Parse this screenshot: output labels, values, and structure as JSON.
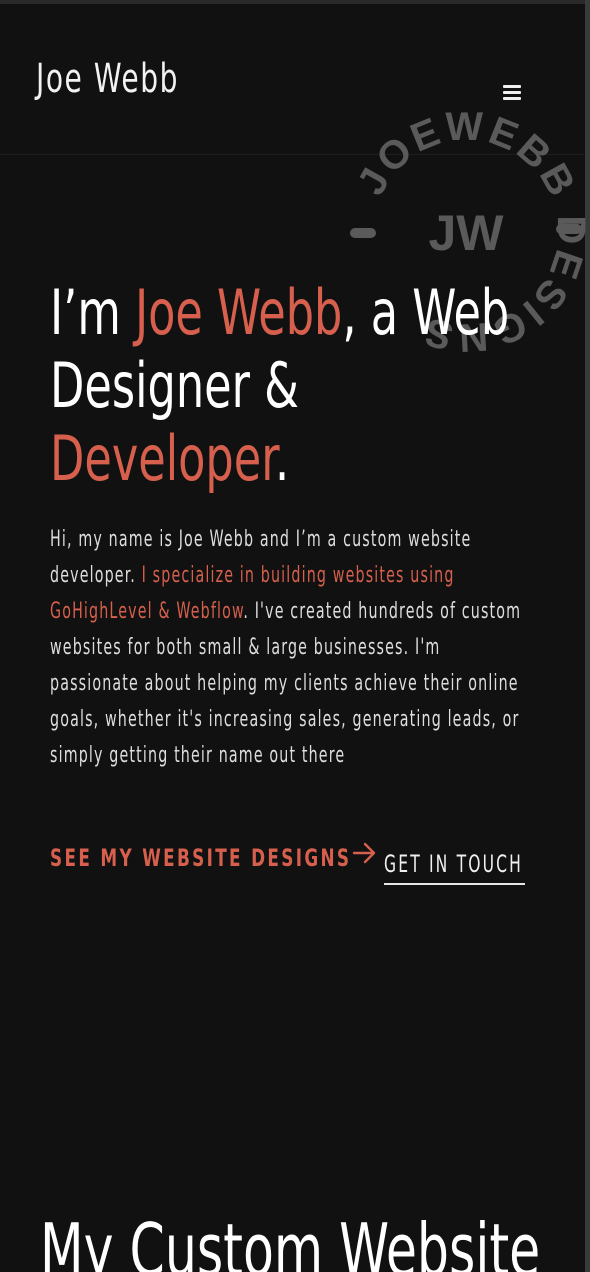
{
  "header": {
    "logo": "Joe Webb",
    "menu_icon": "hamburger-menu-icon"
  },
  "badge": {
    "ring_text": "JOEWEBB DESIGNS",
    "monogram": "JW",
    "color": "#5a5a5a"
  },
  "hero": {
    "title_part1": "I’m ",
    "title_name": "Joe Webb",
    "title_part2": ", a Web Designer & ",
    "title_role": "Developer",
    "title_end": ".",
    "intro_part1": "Hi, my name is Joe Webb and I’m a custom website developer. ",
    "intro_highlight": "I specialize in building websites using GoHighLevel & Webflow",
    "intro_part2": ". I've created hundreds of custom websites for both small & large businesses. I'm passionate about helping my clients achieve their online goals, whether it's increasing sales, generating leads, or simply getting their name out there",
    "cta_primary": "SEE MY WEBSITE DESIGNS",
    "cta_primary_icon": "arrow-right-icon",
    "cta_secondary": "GET IN TOUCH"
  },
  "next_section": {
    "title": "My Custom Website"
  },
  "colors": {
    "background": "#111111",
    "accent": "#d6604d",
    "text": "#e8e8e8"
  }
}
